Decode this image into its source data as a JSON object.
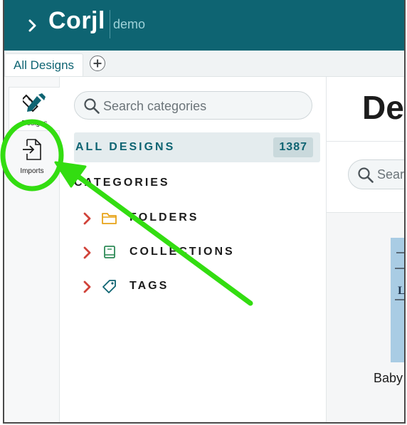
{
  "header": {
    "logo_text": "Corjl",
    "logo_suffix": "demo",
    "accent_color": "#0e6472"
  },
  "tabs": {
    "items": [
      {
        "label": "All Designs"
      }
    ],
    "add_icon": "plus-icon"
  },
  "rail": {
    "items": [
      {
        "label": "Designs",
        "icon": "design-tools-icon",
        "active": true
      },
      {
        "label": "Imports",
        "icon": "import-file-icon",
        "active": false
      }
    ]
  },
  "categories_panel": {
    "search_placeholder": "Search categories",
    "all_designs": {
      "label": "ALL DESIGNS",
      "count": "1387"
    },
    "heading": "CATEGORIES",
    "items": [
      {
        "label": "FOLDERS",
        "icon": "folder-icon",
        "icon_color": "#e8a317"
      },
      {
        "label": "COLLECTIONS",
        "icon": "book-icon",
        "icon_color": "#2e8b57"
      },
      {
        "label": "TAGS",
        "icon": "tag-icon",
        "icon_color": "#0e6472"
      }
    ],
    "chevron_color": "#d0433a"
  },
  "main": {
    "title": "De",
    "search_placeholder": "Searc",
    "card_caption": "Baby A"
  },
  "annotation": {
    "highlight_color": "#33dd11",
    "target": "Imports"
  }
}
